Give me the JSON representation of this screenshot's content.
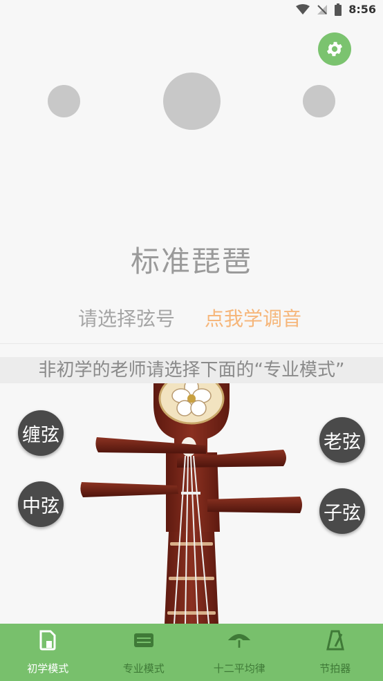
{
  "status_bar": {
    "time": "8:56"
  },
  "title": "标准琵琶",
  "select_prompt": "请选择弦号",
  "learn_link": "点我学调音",
  "hint": "非初学的老师请选择下面的“专业模式”",
  "strings": {
    "chan": "缠弦",
    "zhong": "中弦",
    "lao": "老弦",
    "zi": "子弦"
  },
  "nav": [
    {
      "label": "初学模式",
      "icon": "beginner-icon",
      "active": true
    },
    {
      "label": "专业模式",
      "icon": "professional-icon",
      "active": false
    },
    {
      "label": "十二平均律",
      "icon": "temperament-icon",
      "active": false
    },
    {
      "label": "节拍器",
      "icon": "metronome-icon",
      "active": false
    }
  ],
  "colors": {
    "accent_green": "#78c06c",
    "link_orange": "#f6b67a",
    "wood": "#7a2418"
  }
}
